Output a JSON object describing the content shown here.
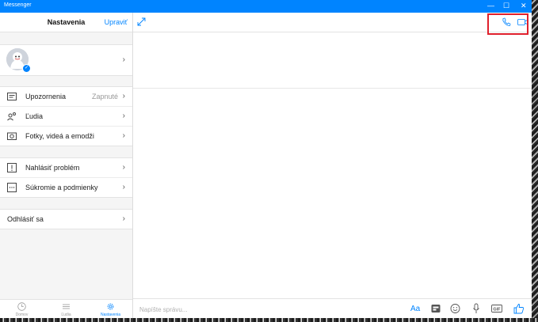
{
  "window": {
    "title": "Messenger",
    "controls": [
      "—",
      "☐",
      "✕"
    ]
  },
  "left": {
    "header": {
      "title": "Nastavenia",
      "edit_label": "Upraviť"
    },
    "settings": [
      {
        "label": "Upozornenia",
        "value": "Zapnuté",
        "icon": "notification-icon"
      },
      {
        "label": "Ľudia",
        "value": "",
        "icon": "people-icon"
      },
      {
        "label": "Fotky, videá a emodži",
        "value": "",
        "icon": "photo-icon"
      }
    ],
    "support": [
      {
        "label": "Nahlásiť problém",
        "icon": "report-icon"
      },
      {
        "label": "Súkromie a podmienky",
        "icon": "privacy-icon"
      }
    ],
    "signout_label": "Odhlásiť sa",
    "nav": [
      {
        "label": "Domov",
        "icon": "clock-icon",
        "active": false
      },
      {
        "label": "Ľudia",
        "icon": "list-icon",
        "active": false
      },
      {
        "label": "Nastavenia",
        "icon": "gear-icon",
        "active": true
      }
    ]
  },
  "composer": {
    "placeholder": "Napíšte správu..."
  },
  "colors": {
    "accent": "#0084ff",
    "highlight": "#e0202c"
  }
}
